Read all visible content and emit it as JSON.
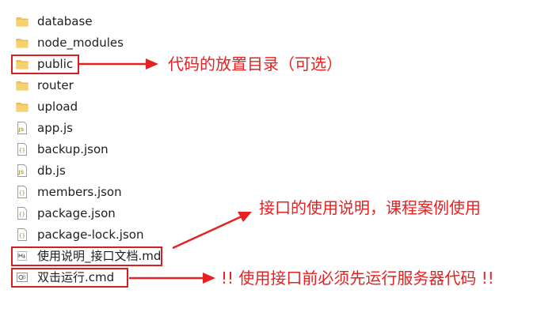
{
  "files": [
    {
      "name": "database",
      "icon": "folder-icon"
    },
    {
      "name": "node_modules",
      "icon": "folder-icon"
    },
    {
      "name": "public",
      "icon": "folder-icon"
    },
    {
      "name": "router",
      "icon": "folder-icon"
    },
    {
      "name": "upload",
      "icon": "folder-icon"
    },
    {
      "name": "app.js",
      "icon": "js-file-icon"
    },
    {
      "name": "backup.json",
      "icon": "json-file-icon"
    },
    {
      "name": "db.js",
      "icon": "js-file-icon"
    },
    {
      "name": "members.json",
      "icon": "json-file-icon"
    },
    {
      "name": "package.json",
      "icon": "json-file-icon"
    },
    {
      "name": "package-lock.json",
      "icon": "json-file-icon"
    },
    {
      "name": "使用说明_接口文档.md",
      "icon": "markdown-file-icon"
    },
    {
      "name": "双击运行.cmd",
      "icon": "cmd-file-icon"
    }
  ],
  "annotations": {
    "public_note": "代码的放置目录（可选）",
    "readme_note": "接口的使用说明，课程案例使用",
    "cmd_note": "!! 使用接口前必须先运行服务器代码 !!"
  },
  "colors": {
    "annotation": "#e52121",
    "highlight_border": "#d42020",
    "folder": "#f2c65a",
    "text": "#1e1e1e"
  }
}
